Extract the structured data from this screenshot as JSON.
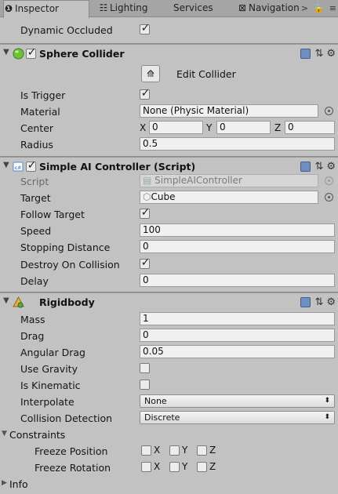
{
  "tabs": [
    {
      "label": "Inspector",
      "icon": "info-icon",
      "active": true
    },
    {
      "label": "Lighting",
      "icon": "lighting-icon",
      "active": false
    },
    {
      "label": "Services",
      "icon": "",
      "active": false
    },
    {
      "label": "Navigation",
      "icon": "navigation-icon",
      "active": false
    }
  ],
  "tab_ops": {
    "overflow": ">",
    "lock": "🔒",
    "menu": "≡"
  },
  "top": {
    "dynamic_occluded_label": "Dynamic Occluded",
    "dynamic_occluded": true
  },
  "sphere_collider": {
    "title": "Sphere Collider",
    "enabled": true,
    "edit_label": "Edit Collider",
    "is_trigger_label": "Is Trigger",
    "is_trigger": true,
    "material_label": "Material",
    "material_value": "None (Physic Material)",
    "center_label": "Center",
    "center": {
      "x_label": "X",
      "x": "0",
      "y_label": "Y",
      "y": "0",
      "z_label": "Z",
      "z": "0"
    },
    "radius_label": "Radius",
    "radius": "0.5"
  },
  "ai_controller": {
    "title": "Simple AI Controller (Script)",
    "enabled": true,
    "script_label": "Script",
    "script_value": "SimpleAIController",
    "target_label": "Target",
    "target_value": "Cube",
    "follow_target_label": "Follow Target",
    "follow_target": true,
    "speed_label": "Speed",
    "speed": "100",
    "stopping_distance_label": "Stopping Distance",
    "stopping_distance": "0",
    "destroy_on_collision_label": "Destroy On Collision",
    "destroy_on_collision": true,
    "delay_label": "Delay",
    "delay": "0"
  },
  "rigidbody": {
    "title": "Rigidbody",
    "mass_label": "Mass",
    "mass": "1",
    "drag_label": "Drag",
    "drag": "0",
    "angular_drag_label": "Angular Drag",
    "angular_drag": "0.05",
    "use_gravity_label": "Use Gravity",
    "use_gravity": false,
    "is_kinematic_label": "Is Kinematic",
    "is_kinematic": false,
    "interpolate_label": "Interpolate",
    "interpolate": "None",
    "collision_detection_label": "Collision Detection",
    "collision_detection": "Discrete",
    "constraints_label": "Constraints",
    "freeze_position_label": "Freeze Position",
    "freeze_rotation_label": "Freeze Rotation",
    "axis_x": "X",
    "axis_y": "Y",
    "axis_z": "Z",
    "info_label": "Info"
  },
  "colors": {
    "panel_bg": "#c2c2c2",
    "field_bg": "#f0f0f0",
    "sphere_icon": "#6ec23a",
    "script_icon": "#5b86c5"
  }
}
